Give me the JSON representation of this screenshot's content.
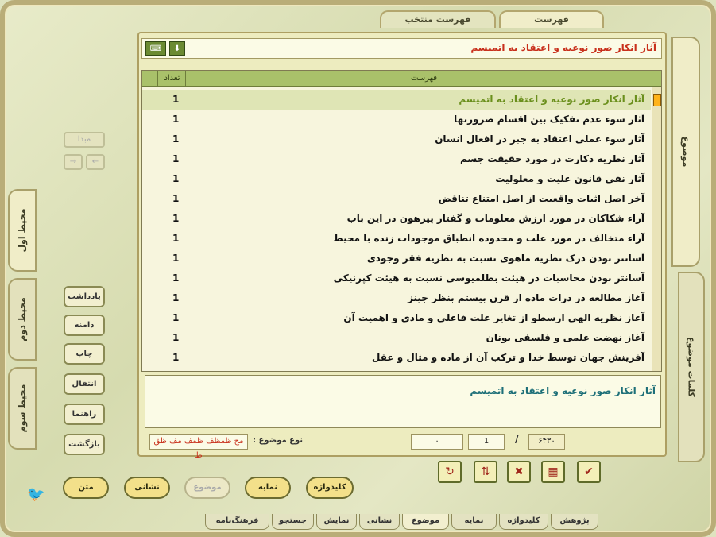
{
  "top_tabs": [
    "فهرست",
    "فهرست منتخب"
  ],
  "header": {
    "title": "آثار انکار صور نوعیه و اعتقاد به اتمیسم",
    "keyboard_icon": "keyboard-icon",
    "down_icon": "arrow-down-icon"
  },
  "list": {
    "col_count": "تعداد",
    "col_title": "فهرست",
    "rows": [
      {
        "title": "آثار انکار صور نوعیه و اعتقاد به اتمیسم",
        "count": "1"
      },
      {
        "title": "آثار سوء عدم تفکیک بین اقسام ضرورتها",
        "count": "1"
      },
      {
        "title": "آثار سوء عملی اعتقاد به جبر در افعال انسان",
        "count": "1"
      },
      {
        "title": "آثار نظریه دکارت در مورد حقیقت جسم",
        "count": "1"
      },
      {
        "title": "آثار نفی قانون علیت و معلولیت",
        "count": "1"
      },
      {
        "title": "آخر اصل اثبات واقعیت از اصل امتناع تناقض",
        "count": "1"
      },
      {
        "title": "آراء شکاکان در مورد ارزش معلومات و گفتار پیرهون در این باب",
        "count": "1"
      },
      {
        "title": "آراء متخالف در مورد علت و محدوده انطباق موجودات زنده با محیط",
        "count": "1"
      },
      {
        "title": "آسانتر بودن درک نظریه ماهوی نسبت به نظریه فقر وجودی",
        "count": "1"
      },
      {
        "title": "آسانتر بودن محاسبات در هیئت بطلمیوسی نسبت به هیئت کپرنیکی",
        "count": "1"
      },
      {
        "title": "آغاز مطالعه در ذرات ماده از قرن بیستم بنظر جینز",
        "count": "1"
      },
      {
        "title": "آغاز نظریه الهی ارسطو از تغایر علت فاعلی و مادی و اهمیت آن",
        "count": "1"
      },
      {
        "title": "آغاز نهضت علمی و فلسفی یونان",
        "count": "1"
      },
      {
        "title": "آفرینش جهان توسط خدا و ترکب آن از ماده و مثال و عقل",
        "count": "1"
      }
    ]
  },
  "description": "آثار انکار صور نوعیه و اعتقاد به اتمیسم",
  "status": {
    "type_label": "نوع موضوع :",
    "type_value": "مح ظمظف ظمف مف ظق ظ",
    "field_zero": "۰",
    "current": "1",
    "separator": "/",
    "total": "۶۴۳۰"
  },
  "toolbar_icons": [
    "refresh-icon",
    "swap-icon",
    "clear-icon",
    "grid-icon",
    "check-grid-icon"
  ],
  "nav": {
    "start": "مبدا",
    "prev": "→",
    "next": "←"
  },
  "side_buttons": [
    "یادداشت",
    "دامنه",
    "چاپ",
    "انتقال",
    "راهنما",
    "بازگشت"
  ],
  "left_tabs": [
    "محیط اول",
    "محیط دوم",
    "محیط سوم"
  ],
  "right_tabs": [
    "موضوع",
    "کلمات موضوع"
  ],
  "pills": [
    {
      "label": "کلیدواژه",
      "enabled": true
    },
    {
      "label": "نمایه",
      "enabled": true
    },
    {
      "label": "موضوع",
      "enabled": false
    },
    {
      "label": "نشانی",
      "enabled": true
    },
    {
      "label": "متن",
      "enabled": true
    }
  ],
  "bottom_tabs": [
    "پژوهش",
    "کلیدواژه",
    "نمایه",
    "موضوع",
    "نشانی",
    "نمایش",
    "جستجو",
    "فرهنگ‌نامه"
  ]
}
